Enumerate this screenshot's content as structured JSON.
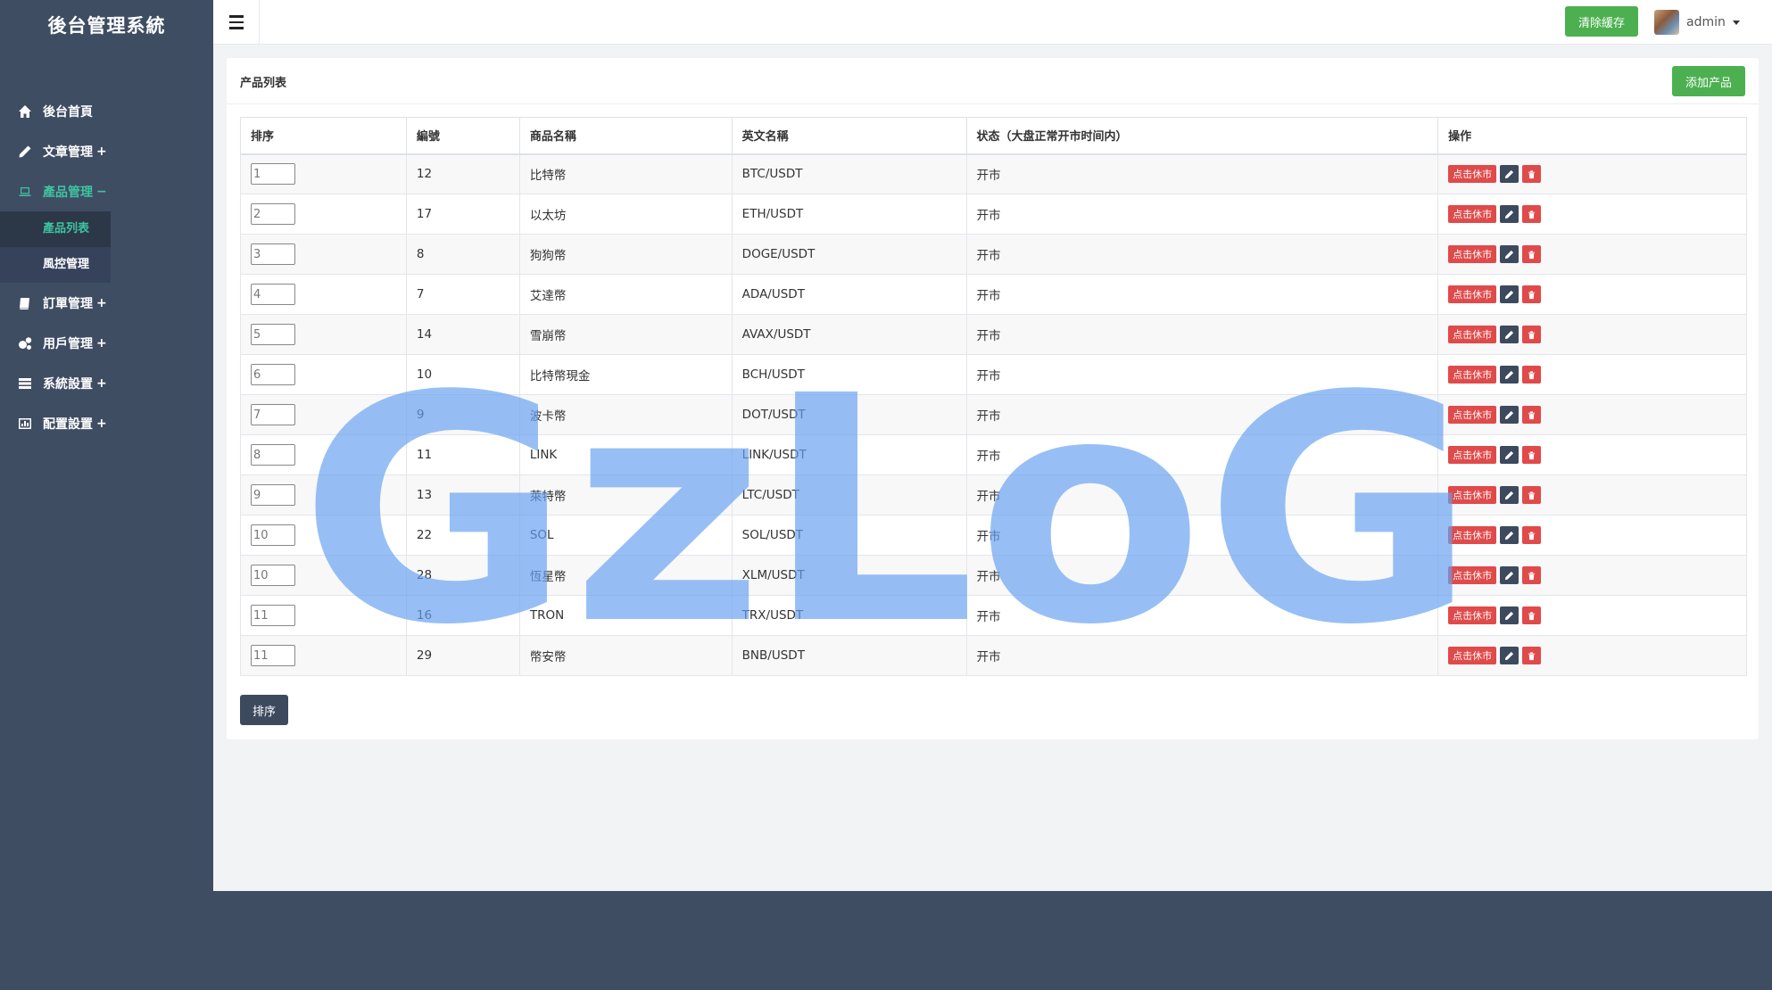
{
  "app": {
    "title": "後台管理系統"
  },
  "sidebar": {
    "items": [
      {
        "label": "後台首頁",
        "suffix": "",
        "icon": "home-icon",
        "active": false
      },
      {
        "label": "文章管理",
        "suffix": "+",
        "icon": "pencil-icon",
        "active": false
      },
      {
        "label": "產品管理",
        "suffix": "−",
        "icon": "laptop-icon",
        "active": true
      },
      {
        "label": "訂單管理",
        "suffix": "+",
        "icon": "book-icon",
        "active": false
      },
      {
        "label": "用戶管理",
        "suffix": "+",
        "icon": "gears-icon",
        "active": false
      },
      {
        "label": "系統設置",
        "suffix": "+",
        "icon": "tasks-icon",
        "active": false
      },
      {
        "label": "配置設置",
        "suffix": "+",
        "icon": "chart-icon",
        "active": false
      }
    ],
    "submenu": [
      {
        "label": "產品列表",
        "active": true
      },
      {
        "label": "風控管理",
        "active": false
      }
    ]
  },
  "topbar": {
    "clear_cache_label": "清除緩存",
    "user_name": "admin"
  },
  "panel": {
    "title": "产品列表",
    "add_label": "添加产品",
    "sort_button_label": "排序"
  },
  "table": {
    "headers": [
      "排序",
      "編號",
      "商品名稱",
      "英文名稱",
      "状态（大盘正常开市时间内）",
      "操作"
    ],
    "toggle_label": "点击休市",
    "rows": [
      {
        "sort": "1",
        "id": "12",
        "name": "比特幣",
        "en": "BTC/USDT",
        "status": "开市"
      },
      {
        "sort": "2",
        "id": "17",
        "name": "以太坊",
        "en": "ETH/USDT",
        "status": "开市"
      },
      {
        "sort": "3",
        "id": "8",
        "name": "狗狗幣",
        "en": "DOGE/USDT",
        "status": "开市"
      },
      {
        "sort": "4",
        "id": "7",
        "name": "艾達幣",
        "en": "ADA/USDT",
        "status": "开市"
      },
      {
        "sort": "5",
        "id": "14",
        "name": "雪崩幣",
        "en": "AVAX/USDT",
        "status": "开市"
      },
      {
        "sort": "6",
        "id": "10",
        "name": "比特幣現金",
        "en": "BCH/USDT",
        "status": "开市"
      },
      {
        "sort": "7",
        "id": "9",
        "name": "波卡幣",
        "en": "DOT/USDT",
        "status": "开市"
      },
      {
        "sort": "8",
        "id": "11",
        "name": "LINK",
        "en": "LINK/USDT",
        "status": "开市"
      },
      {
        "sort": "9",
        "id": "13",
        "name": "萊特幣",
        "en": "LTC/USDT",
        "status": "开市"
      },
      {
        "sort": "10",
        "id": "22",
        "name": "SOL",
        "en": "SOL/USDT",
        "status": "开市"
      },
      {
        "sort": "10",
        "id": "28",
        "name": "恆星幣",
        "en": "XLM/USDT",
        "status": "开市"
      },
      {
        "sort": "11",
        "id": "16",
        "name": "TRON",
        "en": "TRX/USDT",
        "status": "开市"
      },
      {
        "sort": "11",
        "id": "29",
        "name": "幣安幣",
        "en": "BNB/USDT",
        "status": "开市"
      }
    ]
  },
  "watermark": {
    "text": "GzLoG",
    "color": "#66a0f0"
  }
}
